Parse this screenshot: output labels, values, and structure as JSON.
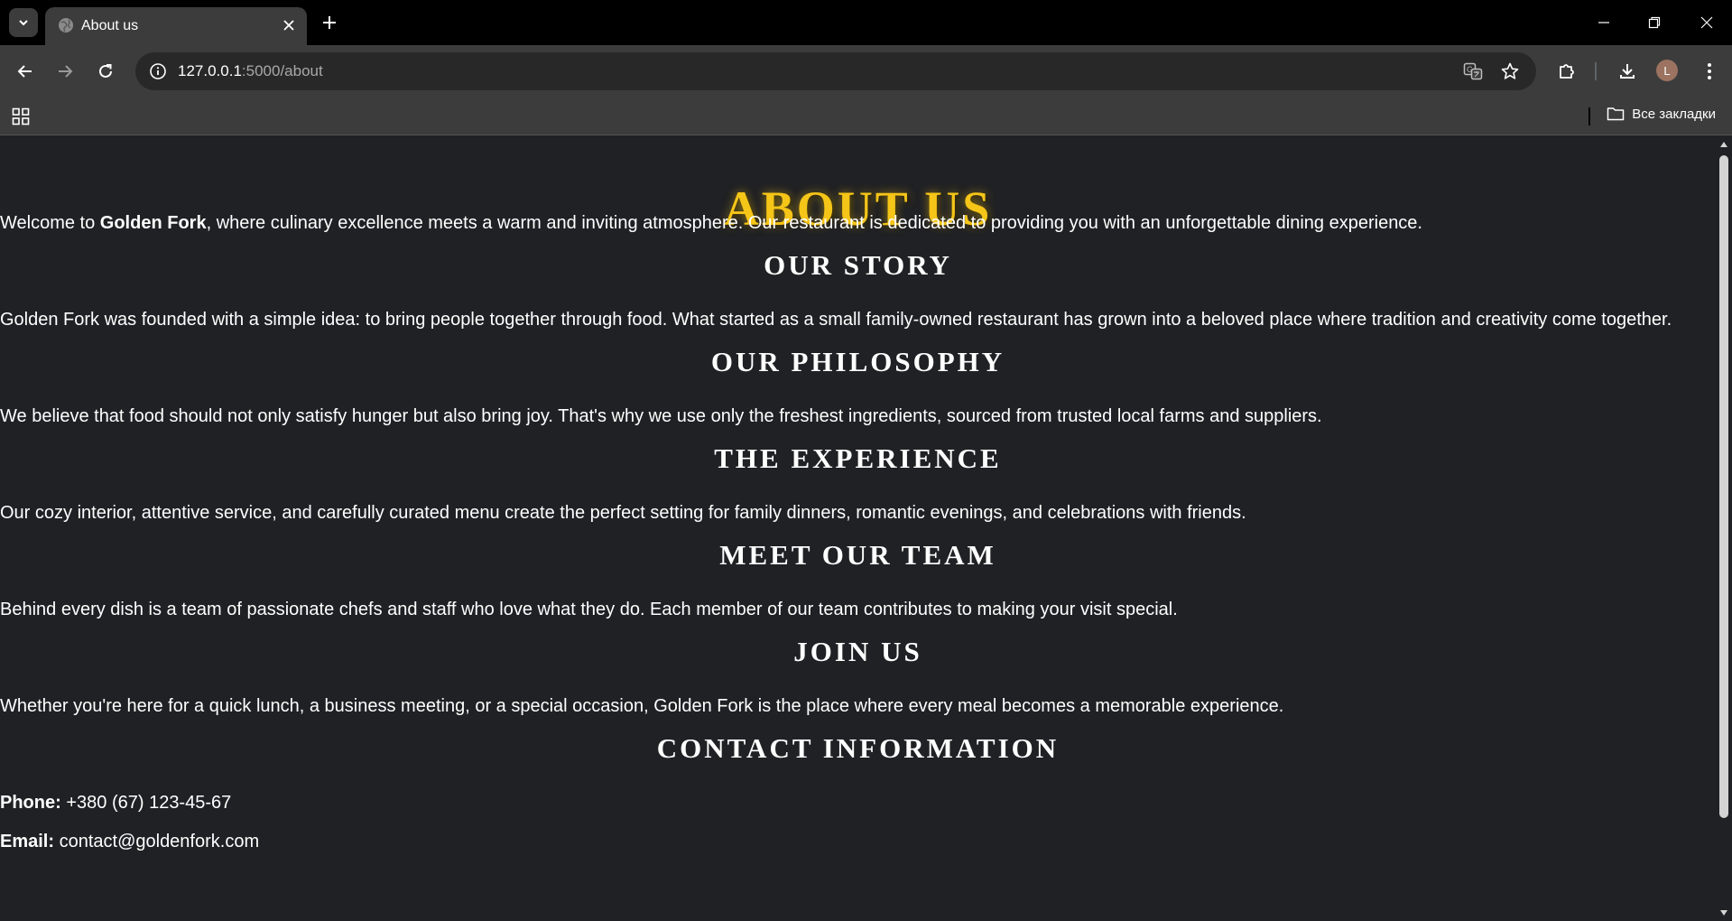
{
  "browser": {
    "tab_title": "About us",
    "url_host": "127.0.0.1",
    "url_path": ":5000/about",
    "profile_initial": "L",
    "bookmarks_label": "Все закладки"
  },
  "page": {
    "title": "ABOUT US",
    "intro": {
      "prefix": "Welcome to ",
      "brand": "Golden Fork",
      "suffix": ", where culinary excellence meets a warm and inviting atmosphere. Our restaurant is dedicated to providing you with an unforgettable dining experience."
    },
    "sections": [
      {
        "heading": "OUR STORY",
        "text": "Golden Fork was founded with a simple idea: to bring people together through food. What started as a small family-owned restaurant has grown into a beloved place where tradition and creativity come together."
      },
      {
        "heading": "OUR PHILOSOPHY",
        "text": "We believe that food should not only satisfy hunger but also bring joy. That's why we use only the freshest ingredients, sourced from trusted local farms and suppliers."
      },
      {
        "heading": "THE EXPERIENCE",
        "text": "Our cozy interior, attentive service, and carefully curated menu create the perfect setting for family dinners, romantic evenings, and celebrations with friends."
      },
      {
        "heading": "MEET OUR TEAM",
        "text": "Behind every dish is a team of passionate chefs and staff who love what they do. Each member of our team contributes to making your visit special."
      },
      {
        "heading": "JOIN US",
        "text": "Whether you're here for a quick lunch, a business meeting, or a special occasion, Golden Fork is the place where every meal becomes a memorable experience."
      }
    ],
    "contact": {
      "heading": "CONTACT INFORMATION",
      "phone_label": "Phone:",
      "phone_value": " +380 (67) 123-45-67",
      "email_label": "Email:",
      "email_value": " contact@goldenfork.com"
    }
  },
  "colors": {
    "page_bg": "#202124",
    "title_gold": "#f5c518",
    "chrome_dark": "#000000",
    "chrome_toolbar": "#3c3c3c"
  },
  "icons": {
    "tab_search": "chevron-down-icon",
    "favicon": "globe-icon",
    "tab_close": "close-icon",
    "new_tab": "plus-icon",
    "minimize": "minimize-icon",
    "restore": "restore-icon",
    "close_window": "close-icon",
    "back": "arrow-left-icon",
    "forward": "arrow-right-icon",
    "reload": "reload-icon",
    "site_info": "info-icon",
    "translate": "translate-icon",
    "bookmark_star": "star-icon",
    "extensions": "puzzle-icon",
    "downloads": "download-icon",
    "menu": "kebab-menu-icon",
    "apps": "apps-grid-icon",
    "folder": "folder-icon"
  }
}
